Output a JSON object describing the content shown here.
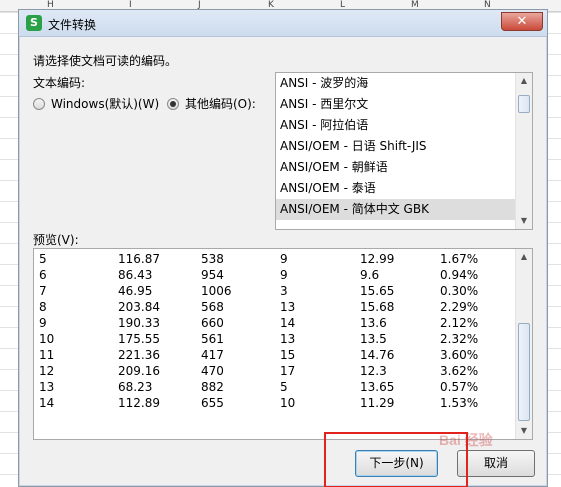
{
  "background": {
    "column_headers": [
      "H",
      "I",
      "J",
      "K",
      "L",
      "M",
      "N"
    ]
  },
  "dialog": {
    "title": "文件转换",
    "logo_letter": "S",
    "close_glyph": "✕",
    "prompt": "请选择使文档可读的编码。",
    "encoding_label": "文本编码:",
    "radio_windows": "Windows(默认)(W)",
    "radio_other": "其他编码(O):",
    "selected_radio": "other",
    "encodings": [
      "ANSI - 波罗的海",
      "ANSI - 西里尔文",
      "ANSI - 阿拉伯语",
      "ANSI/OEM - 日语 Shift-JIS",
      "ANSI/OEM - 朝鲜语",
      "ANSI/OEM - 泰语",
      "ANSI/OEM - 简体中文 GBK"
    ],
    "selected_encoding": "ANSI/OEM - 简体中文 GBK",
    "preview_label": "预览(V):",
    "preview_rows": [
      [
        "5",
        "116.87",
        "538",
        "9",
        "12.99",
        "1.67%"
      ],
      [
        "6",
        "86.43",
        "954",
        "9",
        "9.6",
        "0.94%"
      ],
      [
        "7",
        "46.95",
        "1006",
        "3",
        "15.65",
        "0.30%"
      ],
      [
        "8",
        "203.84",
        "568",
        "13",
        "15.68",
        "2.29%"
      ],
      [
        "9",
        "190.33",
        "660",
        "14",
        "13.6",
        "2.12%"
      ],
      [
        "10",
        "175.55",
        "561",
        "13",
        "13.5",
        "2.32%"
      ],
      [
        "11",
        "221.36",
        "417",
        "15",
        "14.76",
        "3.60%"
      ],
      [
        "12",
        "209.16",
        "470",
        "17",
        "12.3",
        "3.62%"
      ],
      [
        "13",
        "68.23",
        "882",
        "5",
        "13.65",
        "0.57%"
      ],
      [
        "14",
        "112.89",
        "655",
        "10",
        "11.29",
        "1.53%"
      ]
    ],
    "next_button": "下一步(N)",
    "cancel_button": "取消",
    "scroll_up_glyph": "▲",
    "scroll_down_glyph": "▼"
  },
  "watermark": "Bai 经验",
  "colors": {
    "highlight_box": "#e2221c",
    "logo_green": "#2aa148",
    "close_red": "#c9493a"
  }
}
